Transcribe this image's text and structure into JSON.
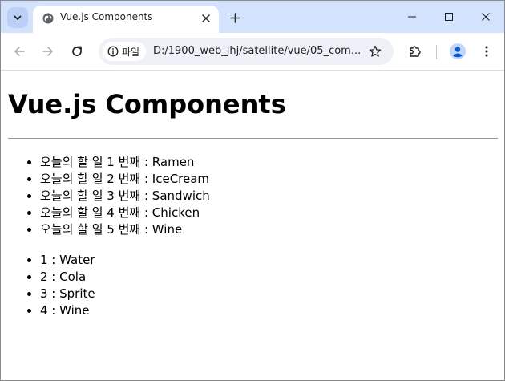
{
  "browser": {
    "tab_title": "Vue.js Components",
    "site_info_label": "파일",
    "url": "D:/1900_web_jhj/satellite/vue/05_com..."
  },
  "page": {
    "title": "Vue.js Components",
    "todo_items": [
      "오늘의 할 일 1 번째 : Ramen",
      "오늘의 할 일 2 번째 : IceCream",
      "오늘의 할 일 3 번째 : Sandwich",
      "오늘의 할 일 4 번째 : Chicken",
      "오늘의 할 일 5 번째 : Wine"
    ],
    "drink_items": [
      "1 : Water",
      "2 : Cola",
      "3 : Sprite",
      "4 : Wine"
    ]
  },
  "icons": {
    "tab_search": "chevron-down-icon",
    "favicon": "globe-icon",
    "tab_close": "close-icon",
    "new_tab": "plus-icon",
    "back": "arrow-left-icon",
    "forward": "arrow-right-icon",
    "reload": "reload-icon",
    "site_info": "info-icon",
    "bookmark": "star-icon",
    "extensions": "puzzle-icon",
    "profile": "person-icon",
    "menu": "kebab-menu-icon",
    "minimize": "minimize-icon",
    "maximize": "maximize-icon",
    "close_window": "close-icon"
  },
  "colors": {
    "tab_strip": "#d3e3fd",
    "omnibox": "#eef1f8",
    "profile_accent": "#0b57d0"
  }
}
